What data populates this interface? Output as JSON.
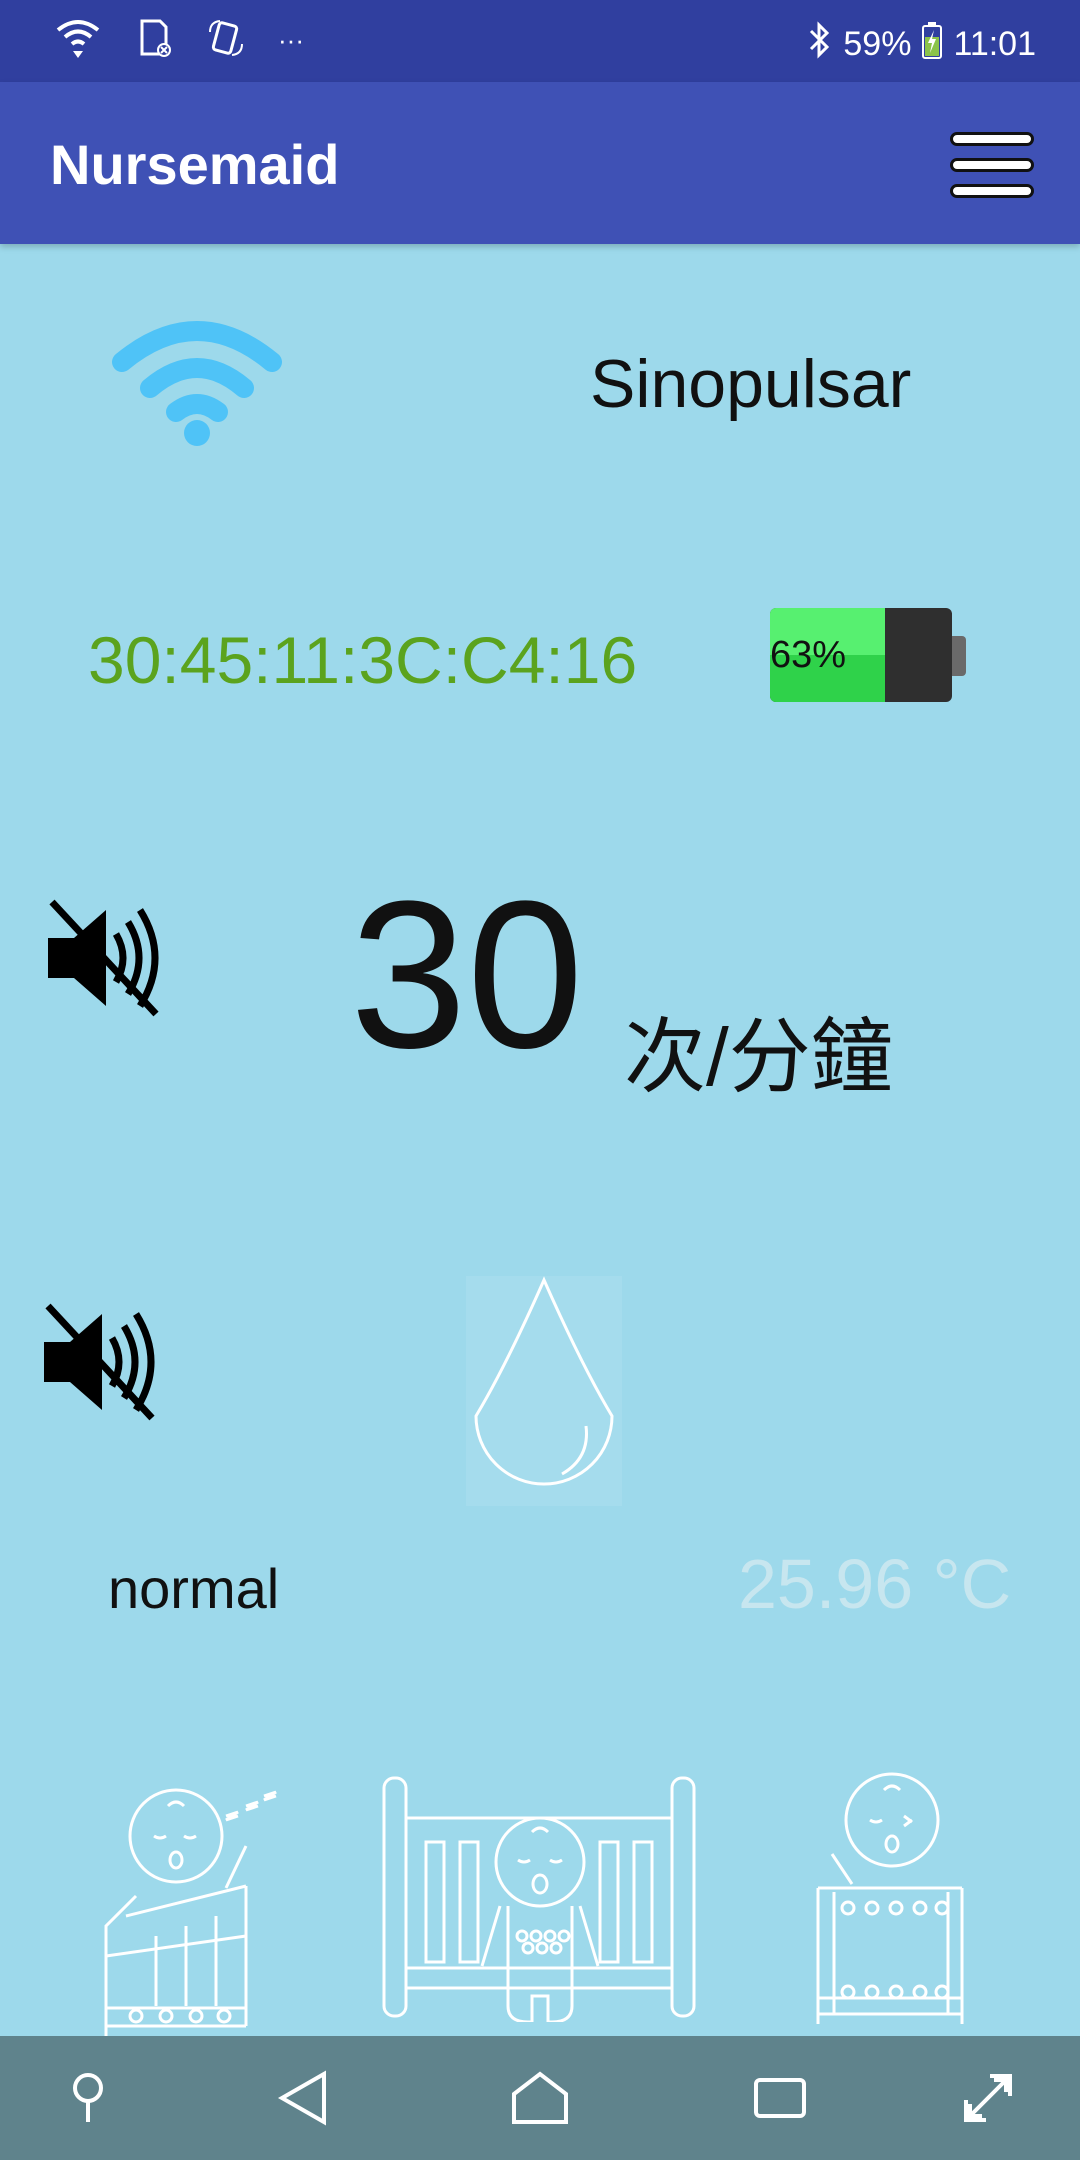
{
  "status_bar": {
    "battery_percent": "59%",
    "time": "11:01",
    "overflow": "···",
    "icons": [
      "wifi-icon",
      "sd-card-icon",
      "phone-rotate-icon",
      "bluetooth-icon",
      "battery-charging-icon"
    ]
  },
  "app_bar": {
    "title": "Nursemaid",
    "menu_icon": "hamburger-menu-icon"
  },
  "device": {
    "name": "Sinopulsar",
    "mac": "30:45:11:3C:C4:16",
    "battery_label": "63%",
    "battery_level": 0.63,
    "connection_icon": "wifi-icon"
  },
  "breathing": {
    "rate": "30",
    "unit": "次/分鐘",
    "alarm_icon": "speaker-muted-icon"
  },
  "moisture": {
    "alarm_icon": "speaker-muted-icon",
    "drop_icon": "water-drop-icon",
    "status": "normal",
    "temperature": "25.96 °C"
  },
  "illustrations": [
    "baby-sleeping-crib-icon",
    "baby-standing-crib-icon",
    "baby-waking-crib-icon"
  ],
  "nav_bar": [
    "pin-icon",
    "back-icon",
    "home-icon",
    "recents-icon",
    "expand-icon"
  ],
  "colors": {
    "status_bar": "#303f9f",
    "app_bar": "#3f51b5",
    "background": "#9dd9eb",
    "mac_text": "#5ba31e",
    "battery_fill": "#2fd24a",
    "nav_bar": "#5f838c"
  }
}
